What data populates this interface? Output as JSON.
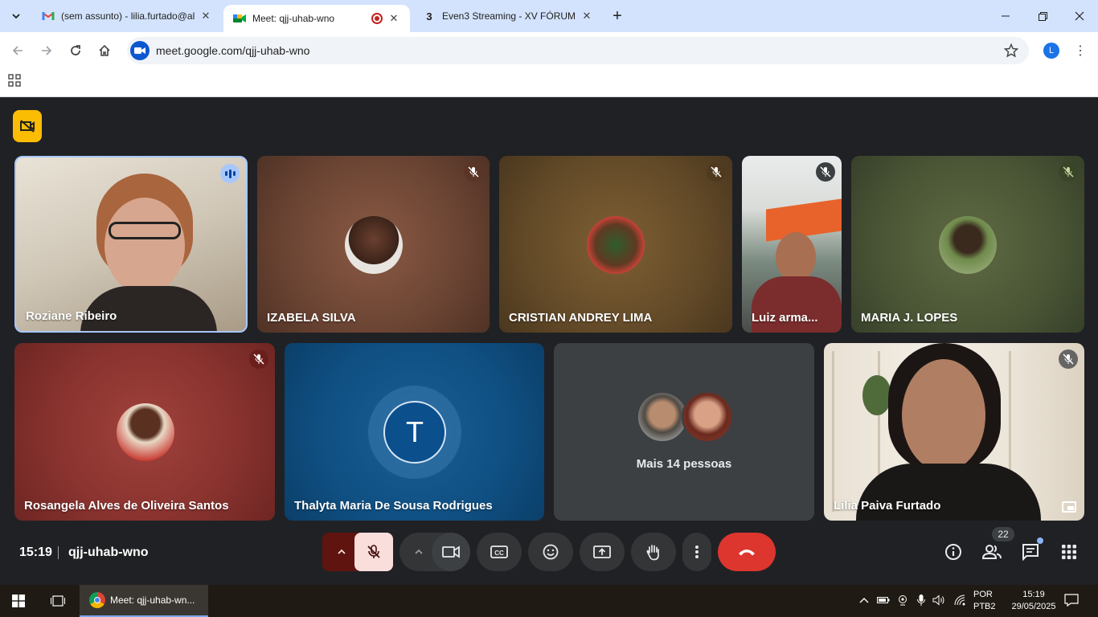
{
  "browser": {
    "tabs": [
      {
        "title": "(sem assunto) - lilia.furtado@al",
        "icon": "gmail-icon"
      },
      {
        "title": "Meet: qjj-uhab-wno",
        "icon": "meet-icon",
        "active": true,
        "recording": true
      },
      {
        "title": "Even3 Streaming - XV FÓRUM I",
        "icon": "even3-icon",
        "icon_text": "3"
      }
    ],
    "new_tab": "+",
    "url": "meet.google.com/qjj-uhab-wno",
    "profile_initial": "L"
  },
  "meet": {
    "participants_row1": [
      {
        "name": "Roziane Ribeiro",
        "state": "video",
        "speaking": true
      },
      {
        "name": "IZABELA SILVA",
        "state": "avatar",
        "muted": true
      },
      {
        "name": "CRISTIAN ANDREY LIMA",
        "state": "avatar",
        "muted": true
      },
      {
        "name": "Luiz arma...",
        "state": "video",
        "muted": true
      },
      {
        "name": "MARIA J. LOPES",
        "state": "avatar",
        "muted": true
      }
    ],
    "participants_row2": [
      {
        "name": "Rosangela Alves de Oliveira Santos",
        "state": "avatar",
        "muted": true
      },
      {
        "name": "Thalyta Maria De Sousa Rodrigues",
        "state": "initial",
        "initial": "T"
      },
      {
        "name": "Mais 14 pessoas",
        "state": "overflow"
      },
      {
        "name": "Lilia Paiva Furtado",
        "state": "video",
        "muted": true
      }
    ],
    "time": "15:19",
    "meeting_code": "qjj-uhab-wno",
    "participant_count": "22",
    "colors": {
      "end_call": "#ea4335",
      "mic_off_bg": "#f9dedc",
      "accent": "#8ab4f8"
    }
  },
  "taskbar": {
    "app_label": "Meet: qjj-uhab-wn...",
    "lang_line1": "POR",
    "lang_line2": "PTB2",
    "clock_time": "15:19",
    "clock_date": "29/05/2025"
  }
}
